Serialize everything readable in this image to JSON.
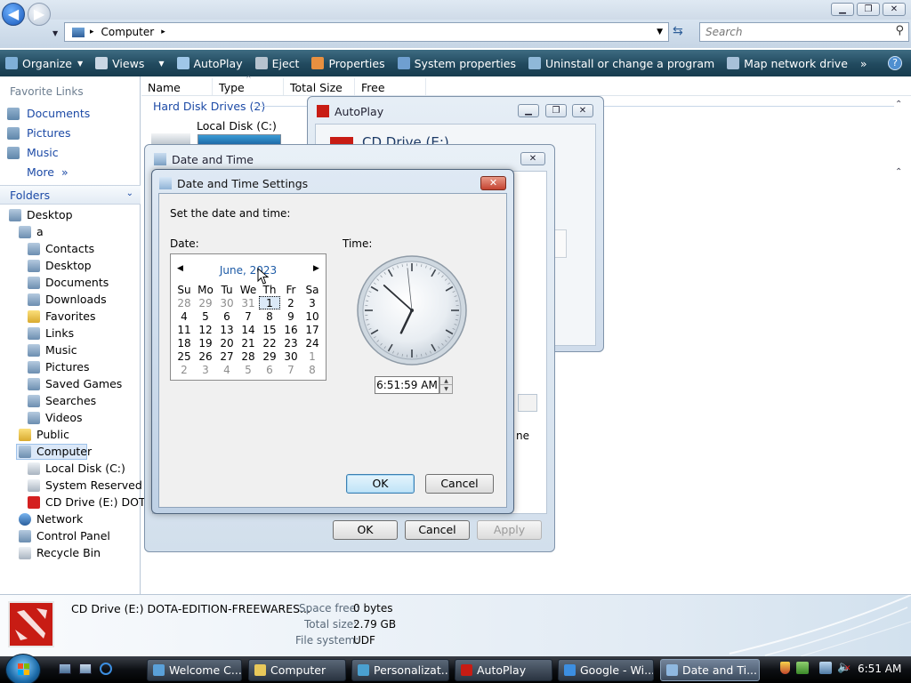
{
  "explorer": {
    "address_path": "Computer",
    "search_placeholder": "Search",
    "toolbar": [
      "Organize",
      "Views",
      "AutoPlay",
      "Eject",
      "Properties",
      "System properties",
      "Uninstall or change a program",
      "Map network drive",
      "»"
    ],
    "favorite_links_title": "Favorite Links",
    "favorite_links": [
      "Documents",
      "Pictures",
      "Music",
      "More"
    ],
    "folders_title": "Folders",
    "tree": {
      "desktop": "Desktop",
      "user": "a",
      "user_children": [
        "Contacts",
        "Desktop",
        "Documents",
        "Downloads",
        "Favorites",
        "Links",
        "Music",
        "Pictures",
        "Saved Games",
        "Searches",
        "Videos"
      ],
      "public": "Public",
      "computer": "Computer",
      "drives": [
        "Local Disk (C:)",
        "System Reserved (D:",
        "CD Drive (E:) DOTA-"
      ],
      "network": "Network",
      "control_panel": "Control Panel",
      "recycle_bin": "Recycle Bin"
    },
    "columns": [
      "Name",
      "Type",
      "Total Size",
      "Free Space"
    ],
    "group_hard_disks": "Hard Disk Drives (2)",
    "local_disk_label": "Local Disk (C:)",
    "details": {
      "name": "CD Drive (E:) DOTA-EDITION-FREEWARES...",
      "space_free_label": "Space free:",
      "space_free_value": "0 bytes",
      "total_size_label": "Total size:",
      "total_size_value": "2.79 GB",
      "file_system_label": "File system:",
      "file_system_value": "UDF"
    }
  },
  "autoplay": {
    "title": "AutoPlay",
    "drive_title": "CD Drive (E:)",
    "partial_text": "ne"
  },
  "datetime": {
    "title": "Date and Time",
    "ok": "OK",
    "cancel": "Cancel",
    "apply": "Apply"
  },
  "dts": {
    "title": "Date and Time Settings",
    "instruction": "Set the date and time:",
    "date_label": "Date:",
    "time_label": "Time:",
    "month_title": "June, 2023",
    "weekdays": [
      "Su",
      "Mo",
      "Tu",
      "We",
      "Th",
      "Fr",
      "Sa"
    ],
    "weeks": [
      [
        "28",
        "29",
        "30",
        "31",
        "1",
        "2",
        "3"
      ],
      [
        "4",
        "5",
        "6",
        "7",
        "8",
        "9",
        "10"
      ],
      [
        "11",
        "12",
        "13",
        "14",
        "15",
        "16",
        "17"
      ],
      [
        "18",
        "19",
        "20",
        "21",
        "22",
        "23",
        "24"
      ],
      [
        "25",
        "26",
        "27",
        "28",
        "29",
        "30",
        "1"
      ],
      [
        "2",
        "3",
        "4",
        "5",
        "6",
        "7",
        "8"
      ]
    ],
    "selected_day": "1",
    "time_value": "6:51:59 AM",
    "ok": "OK",
    "cancel": "Cancel"
  },
  "taskbar": {
    "buttons": [
      {
        "label": "Welcome C...",
        "icon_color": "#5aa0d8"
      },
      {
        "label": "Computer",
        "icon_color": "#e8c85a"
      },
      {
        "label": "Personalizat...",
        "icon_color": "#4aa0d0"
      },
      {
        "label": "AutoPlay",
        "icon_color": "#c81c14"
      },
      {
        "label": "Google - Wi...",
        "icon_color": "#3c8ee0"
      },
      {
        "label": "Date and Ti...",
        "icon_color": "#8fb8e0"
      }
    ],
    "clock": "6:51 AM"
  }
}
